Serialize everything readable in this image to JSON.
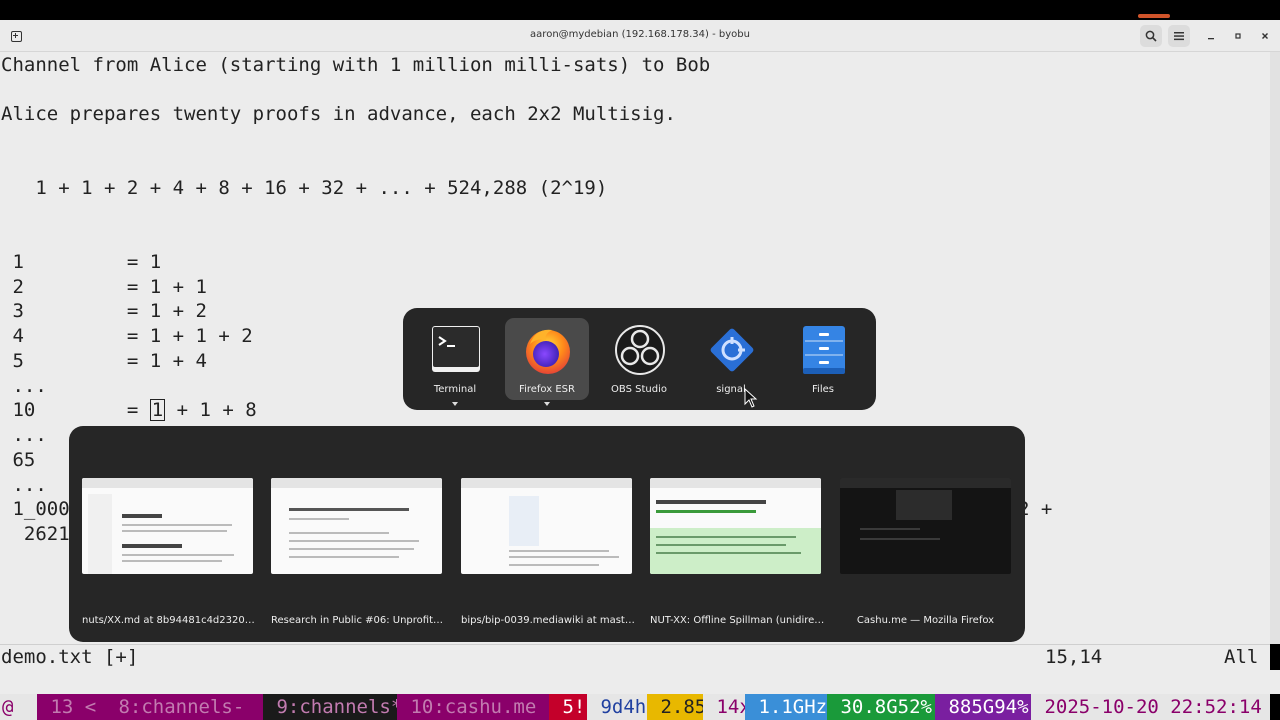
{
  "window": {
    "title": "aaron@mydebian (192.168.178.34) - byobu"
  },
  "terminal": {
    "lines": [
      "Channel from Alice (starting with 1 million milli-sats) to Bob",
      "Alice prepares twenty proofs in advance, each 2x2 Multisig.",
      "   1 + 1 + 2 + 4 + 8 + 16 + 32 + ... + 524,288 (2^19)",
      " 1         = 1",
      " 2         = 1 + 1",
      " 3         = 1 + 2",
      " 4         = 1 + 1 + 2",
      " 5         = 1 + 4",
      " ...",
      " 10        = ",
      " ...",
      " 65",
      " ...",
      " 1_000",
      "  2621"
    ],
    "cursor_char": "1",
    "line10_rest": " + 1 + 8",
    "right_fragment": "2 +"
  },
  "vim_status": {
    "file": "demo.txt [+]",
    "position": "15,14",
    "scroll": "All"
  },
  "byobu": [
    {
      "text": "@",
      "bg": "#e6e6e6",
      "fg": "#8a006a"
    },
    {
      "text": " 13 <",
      "bg": "#8a006a",
      "fg": "#c27bb0"
    },
    {
      "text": " 8:channels-",
      "bg": "#8a006a",
      "fg": "#c27bb0"
    },
    {
      "text": " 9:channels*",
      "bg": "#1a1a1a",
      "fg": "#c27bb0"
    },
    {
      "text": " 10:cashu.me",
      "bg": "#8a006a",
      "fg": "#c27bb0"
    },
    {
      "text": " 5!",
      "bg": "#c4002a",
      "fg": "#ffffff"
    },
    {
      "text": " 9d4h",
      "bg": "#e6e6e6",
      "fg": "#2040a0"
    },
    {
      "text": " 2.85",
      "bg": "#e8b800",
      "fg": "#222222"
    },
    {
      "text": " 14x",
      "bg": "#e6e6e6",
      "fg": "#8a006a"
    },
    {
      "text": " 1.1GHz",
      "bg": "#3a8fd8",
      "fg": "#ffffff"
    },
    {
      "text": " 30.8G52%",
      "bg": "#1a9a3a",
      "fg": "#ffffff"
    },
    {
      "text": " 885G94%",
      "bg": "#7a1fa0",
      "fg": "#ffffff"
    },
    {
      "text": " 2025-10-20 22:52:14",
      "bg": "#e6e6e6",
      "fg": "#8a006a"
    }
  ],
  "switcher": {
    "apps": [
      {
        "label": "Terminal",
        "icon": "terminal-icon",
        "selected": false,
        "has_windows": true
      },
      {
        "label": "Firefox ESR",
        "icon": "firefox-icon",
        "selected": true,
        "has_windows": true
      },
      {
        "label": "OBS Studio",
        "icon": "obs-icon",
        "selected": false,
        "has_windows": false
      },
      {
        "label": "signal",
        "icon": "signal-icon",
        "selected": false,
        "has_windows": false
      },
      {
        "label": "Files",
        "icon": "files-icon",
        "selected": false,
        "has_windows": false
      }
    ],
    "windows": [
      "nuts/XX.md at 8b94481c4d2320e6fd...",
      "Research in Public #06: Unprofitable...",
      "bips/bip-0039.mediawiki at master · ...",
      "NUT-XX: Offline Spillman (unidirecti...",
      "Cashu.me — Mozilla Firefox"
    ]
  }
}
